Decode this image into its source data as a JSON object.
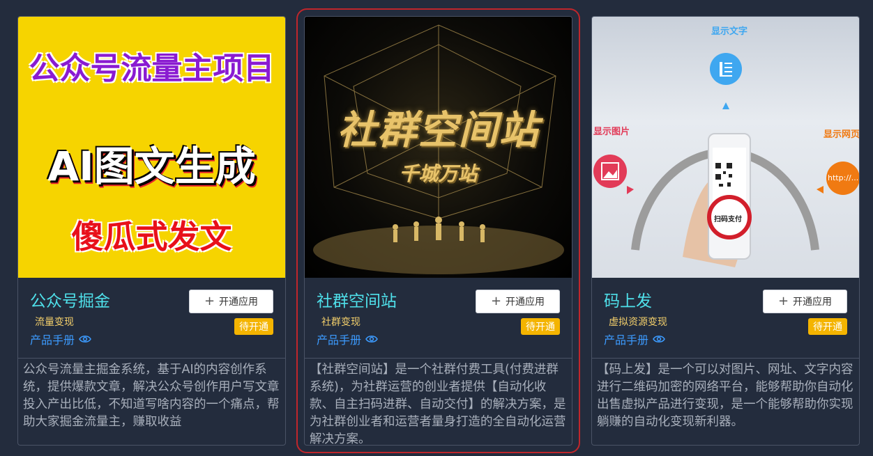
{
  "cards": [
    {
      "cover": {
        "line1": "公众号流量主项目",
        "line2": "AI图文生成",
        "line3": "傻瓜式发文"
      },
      "title": "公众号掘金",
      "category": "流量变现",
      "manual_label": "产品手册",
      "open_label": "开通应用",
      "status": "待开通",
      "description": "公众号流量主掘金系统，基于AI的内容创作系统，提供爆款文章，解决公众号创作用户写文章投入产出比低，不知道写啥内容的一个痛点，帮助大家掘金流量主，赚取收益"
    },
    {
      "cover": {
        "line1": "社群空间站",
        "line2": "千城万站"
      },
      "title": "社群空间站",
      "category": "社群变现",
      "manual_label": "产品手册",
      "open_label": "开通应用",
      "status": "待开通",
      "description": "【社群空间站】是一个社群付费工具(付费进群系统)，为社群运营的创业者提供【自动化收款、自主扫码进群、自动交付】的解决方案，是为社群创业者和运营者量身打造的全自动化运营解决方案。"
    },
    {
      "cover": {
        "label_text": "显示文字",
        "label_image": "显示图片",
        "label_web": "显示网页",
        "url_text": "http://...",
        "pay_text": "扫码支付"
      },
      "title": "码上发",
      "category": "虚拟资源变现",
      "manual_label": "产品手册",
      "open_label": "开通应用",
      "status": "待开通",
      "description": "【码上发】是一个可以对图片、网址、文字内容进行二维码加密的网络平台，能够帮助你自动化出售虚拟产品进行变现，是一个能够帮助你实现躺赚的自动化变现新利器。"
    }
  ],
  "colors": {
    "background": "#232c3d",
    "title": "#4fe0ea",
    "category": "#f3cf6b",
    "link": "#3c9bff",
    "badge": "#f4b400",
    "selected_outline": "#c0262b"
  },
  "icons": {
    "manual": "eye-icon",
    "open": "plus-icon"
  }
}
